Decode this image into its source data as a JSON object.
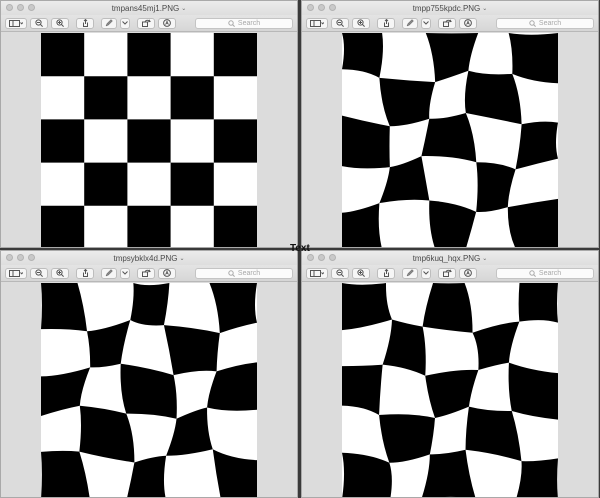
{
  "windows": [
    {
      "title": "tmpans45mj1.PNG",
      "search_placeholder": "Search",
      "distortion": "none"
    },
    {
      "title": "tmpp755kpdc.PNG",
      "search_placeholder": "Search",
      "distortion": "warp"
    },
    {
      "title": "tmpsybklx4d.PNG",
      "search_placeholder": "Search",
      "distortion": "warp"
    },
    {
      "title": "tmp6kuq_hqx.PNG",
      "search_placeholder": "Search",
      "distortion": "warp"
    }
  ],
  "overlay": {
    "text": "Text"
  },
  "colors": {
    "dark": "#000000",
    "light": "#ffffff",
    "chrome": "#dcdcdc"
  },
  "icons": [
    "sidebar-icon",
    "zoom-out-icon",
    "zoom-in-icon",
    "share-icon",
    "pen-icon",
    "chevron-down-icon",
    "rotate-icon",
    "annotate-icon",
    "search-icon"
  ]
}
